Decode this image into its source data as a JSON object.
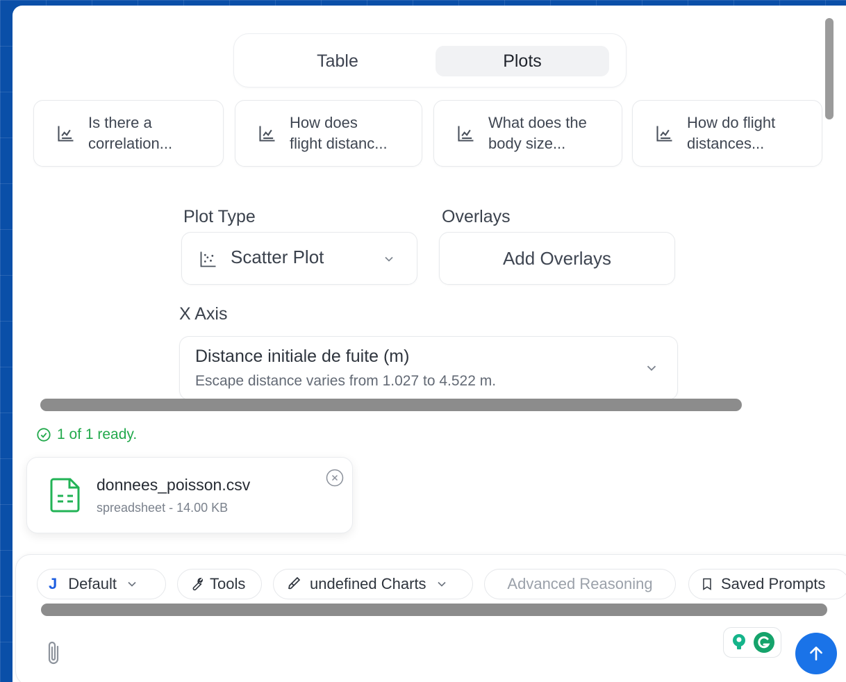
{
  "view_toggle": {
    "tabs": [
      {
        "label": "Table",
        "active": false
      },
      {
        "label": "Plots",
        "active": true
      }
    ]
  },
  "suggestions": [
    {
      "line1": "Is there a",
      "line2": "correlation..."
    },
    {
      "line1": "How does",
      "line2": "flight distanc..."
    },
    {
      "line1": "What does the",
      "line2": "body size..."
    },
    {
      "line1": "How do flight",
      "line2": "distances..."
    }
  ],
  "plot_type": {
    "label": "Plot Type",
    "value": "Scatter Plot"
  },
  "overlays": {
    "label": "Overlays",
    "button_label": "Add Overlays"
  },
  "x_axis": {
    "label": "X Axis",
    "value": "Distance initiale de fuite (m)",
    "description": "Escape distance varies from 1.027 to 4.522 m."
  },
  "upload_status": "1 of 1 ready.",
  "file": {
    "name": "donnees_poisson.csv",
    "meta": "spreadsheet - 14.00 KB"
  },
  "composer": {
    "model_initial": "J",
    "model_label": "Default",
    "tools_label": "Tools",
    "charts_label": "undefined Charts",
    "reasoning_label": "Advanced Reasoning",
    "saved_prompts_label": "Saved Prompts"
  },
  "colors": {
    "background": "#0a4fa8",
    "success": "#22a94c",
    "send_button": "#1a73e8",
    "model_initial": "#1f5fe0"
  }
}
